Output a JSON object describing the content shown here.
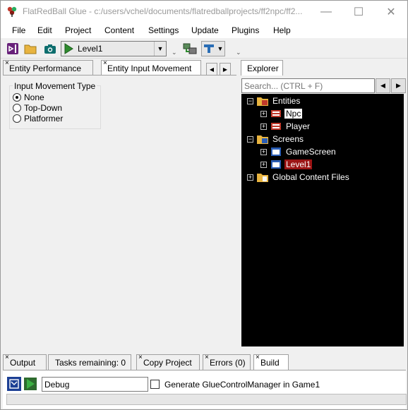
{
  "window": {
    "title": "FlatRedBall Glue - c:/users/vchel/documents/flatredballprojects/ff2npc/ff2...",
    "minimize_glyph": "—",
    "maximize_glyph": "☐",
    "close_glyph": "✕"
  },
  "menu": {
    "items": [
      "File",
      "Edit",
      "Project",
      "Content",
      "Settings",
      "Update",
      "Plugins",
      "Help"
    ]
  },
  "toolbar": {
    "startup_screen": "Level1",
    "dropdown_glyph": "▼",
    "grip_glyph": "⌄"
  },
  "left_tabs": [
    {
      "label": "Entity Performance",
      "close": "×"
    },
    {
      "label": "Entity Input Movement",
      "close": "×"
    }
  ],
  "tab_nav": {
    "prev": "◀",
    "next": "▶"
  },
  "input_movement": {
    "title": "Input Movement Type",
    "options": [
      "None",
      "Top-Down",
      "Platformer"
    ],
    "selected": "None"
  },
  "explorer": {
    "tab_label": "Explorer",
    "search_placeholder": "Search... (CTRL + F)",
    "back_glyph": "◀",
    "forward_glyph": "▶",
    "expander_collapsed": "+",
    "expander_expanded": "−",
    "tree": {
      "entities": "Entities",
      "npc": "Npc",
      "player": "Player",
      "screens": "Screens",
      "gamescreen": "GameScreen",
      "level1": "Level1",
      "global": "Global Content Files"
    }
  },
  "bottom_tabs": [
    {
      "label": "Output",
      "close": "×"
    },
    {
      "label": "Tasks remaining: 0",
      "close": ""
    },
    {
      "label": "Copy Project",
      "close": "×"
    },
    {
      "label": "Errors (0)",
      "close": "×"
    },
    {
      "label": "Build",
      "close": "×"
    }
  ],
  "build": {
    "configuration": "Debug",
    "generate_label": "Generate GlueControlManager in Game1",
    "generate_checked": false,
    "progress": 0
  },
  "colors": {
    "explorer_background": "#000000",
    "selected_screen": "#9b1414",
    "play_green": "#2e8b2e",
    "visual_studio_purple": "#68217a"
  }
}
